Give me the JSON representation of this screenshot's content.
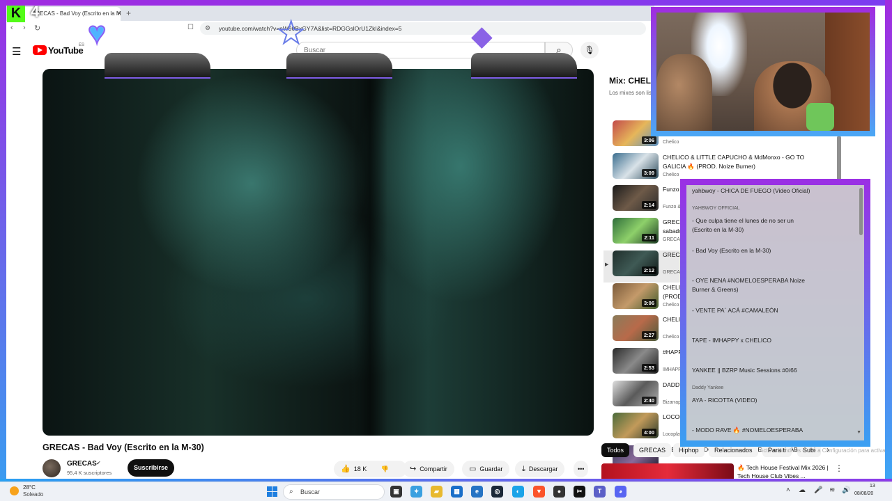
{
  "browser": {
    "tab_title": "GRECAS - Bad Voy (Escrito en la M-30)",
    "tab_close": "×",
    "new_tab": "+",
    "url": "youtube.com/watch?v=nW90BxGY7A&list=RDGGslOrU1ZkI&index=5"
  },
  "stream": {
    "logo_letter": "K",
    "counter": "4"
  },
  "youtube": {
    "logo_text": "YouTube",
    "region": "ES",
    "search_placeholder": "Buscar",
    "video": {
      "title": "GRECAS - Bad Voy (Escrito en la M-30)",
      "channel": "GRECAS",
      "subscribers": "95,4 K suscriptores",
      "subscribe_label": "Suscribirse",
      "likes": "18 K",
      "share_label": "Compartir",
      "save_label": "Guardar",
      "download_label": "Descargar",
      "more_label": "•••"
    },
    "mix": {
      "title": "Mix: CHELICO",
      "subtitle": "Los mixes son listas de reproducción..."
    },
    "playlist": [
      {
        "title": "",
        "channel": "Chelico",
        "duration": "3:06",
        "active": false,
        "colors": [
          "#c24a4a",
          "#e6b65a",
          "#5a8fc2"
        ]
      },
      {
        "title": "CHELICO & LITTLE CAPUCHO & MdMonxo - GO TO GALICIA 🔥 (PROD. Noize Burner)",
        "channel": "Chelico",
        "duration": "3:09",
        "active": false,
        "colors": [
          "#3b6e8f",
          "#d9e2e8",
          "#2c4b5c"
        ]
      },
      {
        "title": "Funzo & Yahbwoy - CHICA DE FUEGO (Video Oficial)",
        "channel": "Funzo & YAHBWOY OFFICIAL",
        "duration": "2:14",
        "active": false,
        "colors": [
          "#1b1b1b",
          "#6e5a48",
          "#2c2c2c"
        ]
      },
      {
        "title": "GRECAS - Que culpa tiene el lunes de no ser un sabado (Escrito en la M-30)",
        "channel": "GRECAS",
        "duration": "2:11",
        "active": false,
        "colors": [
          "#2e6d3a",
          "#8ed06a",
          "#1a3a22"
        ]
      },
      {
        "title": "GRECAS - Bad Voy (Escrito en la M-30)",
        "channel": "GRECAS",
        "duration": "2:12",
        "active": true,
        "colors": [
          "#1f2e2b",
          "#3f5a55",
          "#101816"
        ]
      },
      {
        "title": "CHELICO - OYE NENA #NOMELOESPERABA (PROD. Noize Burner & Greens)",
        "channel": "Chelico",
        "duration": "3:06",
        "active": false,
        "colors": [
          "#7a5a3a",
          "#c49a6a",
          "#3e5a2a"
        ]
      },
      {
        "title": "CHELICO - VENTE PA´ ACÁ #CAMALEÓN",
        "channel": "Chelico",
        "duration": "2:27",
        "active": false,
        "colors": [
          "#8a7b5a",
          "#b86a4a",
          "#4a5a3a"
        ]
      },
      {
        "title": "#HAPPYTAPE - IMHAPPY x CHELICO",
        "channel": "IMHAPPY",
        "duration": "2:53",
        "active": false,
        "colors": [
          "#2a2a2a",
          "#8a8a8a",
          "#1a1a1a"
        ]
      },
      {
        "title": "DADDY YANKEE || BZRP Music Sessions #0/66",
        "channel": "Bizarrap, Daddy Yankee",
        "duration": "2:40",
        "active": false,
        "colors": [
          "#e0e0e0",
          "#5a5a5a",
          "#b0b0b0"
        ]
      },
      {
        "title": "LOCOPLAYA - RICOTTA (VIDEO)",
        "channel": "Locoplaya",
        "duration": "4:00",
        "active": false,
        "colors": [
          "#4a6a3a",
          "#c29a5a",
          "#2a3a2a"
        ]
      },
      {
        "title": "CHELICO - MODO RAVE 🔥 #NOMELOESPERABA",
        "channel": "Chelico",
        "duration": "",
        "active": false,
        "colors": [
          "#3a3a5a",
          "#8a6a9a",
          "#1a1a2a"
        ]
      }
    ],
    "chips": [
      "Todos",
      "GRECAS",
      "Hiphop",
      "Relacionados",
      "Para ti",
      "Subi"
    ],
    "recommendation": {
      "title": "🔥 Tech House Festival Mix 2026 | Tech House Club Vibes ..."
    },
    "watermark": "Activar Windows — Ve a Configuración para activar Windows."
  },
  "overlay_panel": {
    "items": [
      {
        "title": "yahbwoy - CHICA DE FUEGO (Video Oficial)",
        "sub": "YAHBWOY OFFICIAL"
      },
      {
        "title": "- Que culpa tiene el lunes de no ser un (Escrito en la M-30)",
        "sub": ""
      },
      {
        "title": "- Bad Voy (Escrito en la M-30)",
        "sub": ""
      },
      {
        "title": "- OYE NENA #NOMELOESPERABA Noize Burner & Greens)",
        "sub": ""
      },
      {
        "title": "- VENTE PA´ ACÁ #CAMALEÓN",
        "sub": ""
      },
      {
        "title": "TAPE - IMHAPPY x CHELICO",
        "sub": ""
      },
      {
        "title": "YANKEE || BZRP Music Sessions #0/66",
        "sub": "Daddy Yankee"
      },
      {
        "title": "AYA - RICOTTA (VIDEO)",
        "sub": ""
      },
      {
        "title": "- MODO RAVE 🔥 #NOMELOESPERABA",
        "sub": ""
      }
    ]
  },
  "taskbar": {
    "temperature": "28°C",
    "weather": "Soleado",
    "search_label": "Buscar",
    "time": "13",
    "date": "08/08/20"
  }
}
